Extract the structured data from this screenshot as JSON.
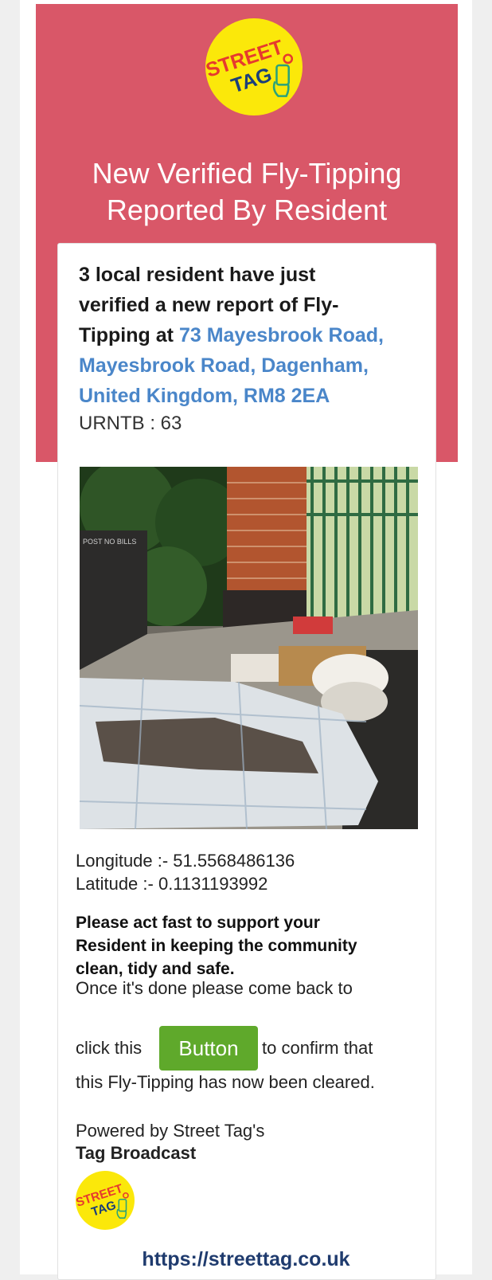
{
  "logo": {
    "line1": "STREET",
    "line2": "TAG",
    "icon": "phone-hand-icon"
  },
  "header": {
    "title_line1": "New Verified Fly-Tipping",
    "title_line2": "Reported By Resident"
  },
  "report": {
    "intro_line1": "3 local resident have just",
    "intro_line2": "verified a new report of Fly-",
    "intro_line3_prefix": "Tipping at",
    "address_line1": "73 Mayesbrook Road,",
    "address_line2": "Mayesbrook Road, Dagenham,",
    "address_line3": "United Kingdom, RM8 2EA",
    "urn": "URNTB : 63"
  },
  "photo": {
    "sign_text": "POST NO BILLS"
  },
  "location": {
    "longitude": "Longitude :- 51.5568486136",
    "latitude": "Latitude :- 0.1131193992"
  },
  "urgent": {
    "line1": "Please act fast to support your",
    "line2": "Resident in keeping the community",
    "line3": "clean, tidy and safe."
  },
  "instructions": {
    "line1": "Once it's done please come back to",
    "before_button": "click this",
    "button_label": "Button",
    "after_button": "to confirm that",
    "line3": "this Fly-Tipping has now been cleared."
  },
  "footer": {
    "powered_by": "Powered by Street Tag's",
    "product": "Tag Broadcast",
    "url": "https://streettag.co.uk"
  },
  "colors": {
    "hero": "#d95768",
    "logo_yellow": "#fbe80a",
    "link": "#4a86c9",
    "button": "#5fa92b",
    "url": "#1f3b6e"
  }
}
